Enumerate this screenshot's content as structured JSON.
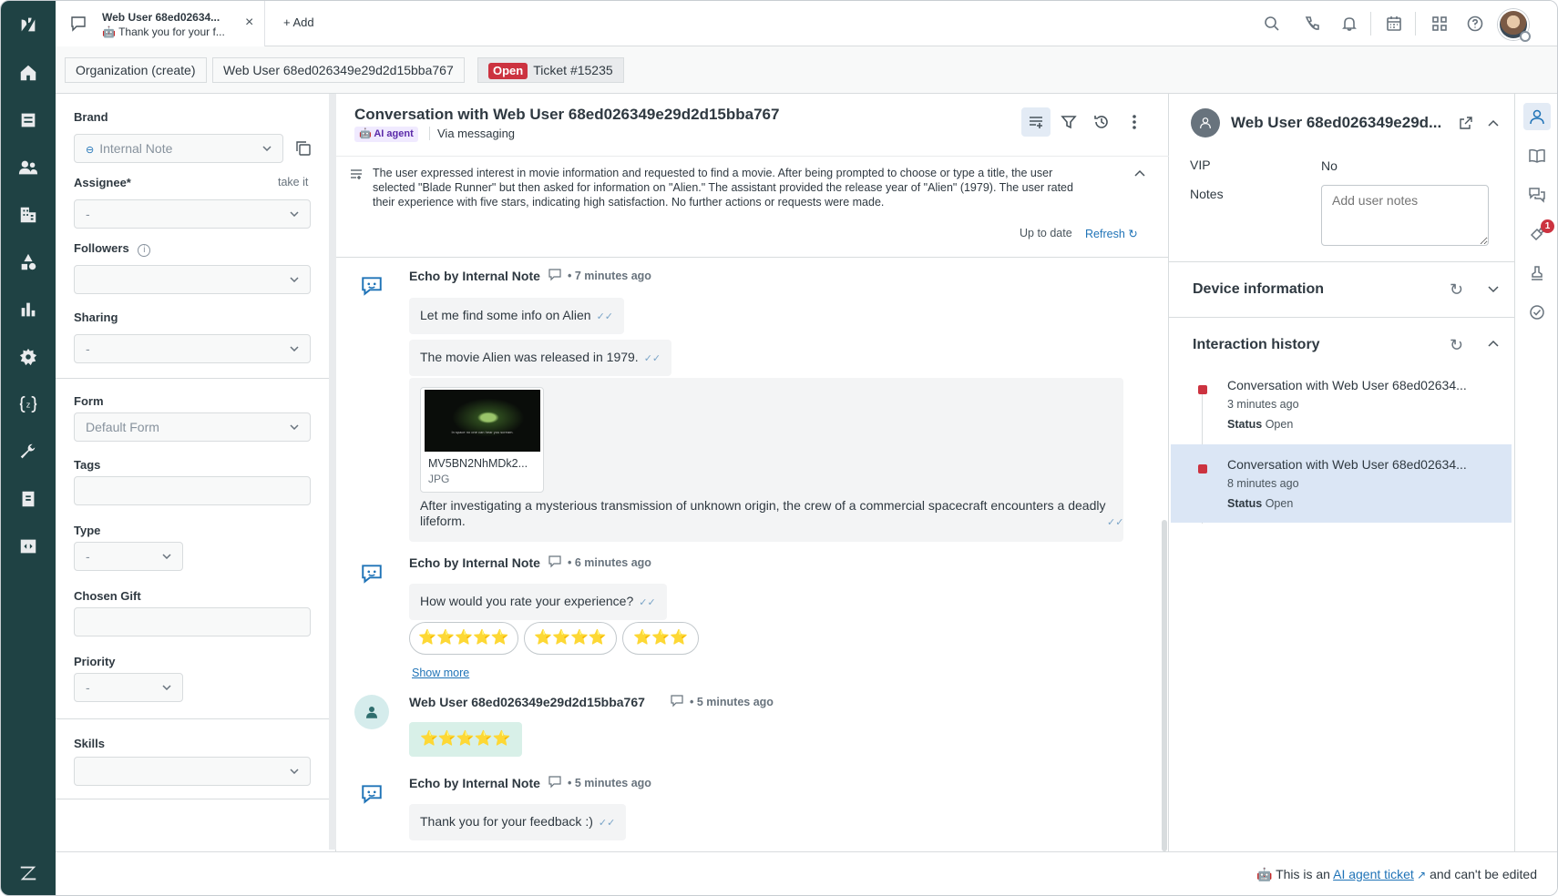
{
  "tab": {
    "title": "Web User 68ed02634...",
    "subtitle": "Thank you for your f...",
    "close": "×"
  },
  "topbar": {
    "add_label": "Add"
  },
  "breadcrumbs": {
    "org": "Organization (create)",
    "user": "Web User 68ed026349e29d2d15bba767",
    "status": "Open",
    "ticket": "Ticket #15235"
  },
  "left": {
    "brand_label": "Brand",
    "brand_value": "Internal Note",
    "assignee_label": "Assignee*",
    "take_it": "take it",
    "assignee_value": "-",
    "followers_label": "Followers",
    "sharing_label": "Sharing",
    "sharing_value": "-",
    "form_label": "Form",
    "form_value": "Default Form",
    "tags_label": "Tags",
    "type_label": "Type",
    "type_value": "-",
    "gift_label": "Chosen Gift",
    "priority_label": "Priority",
    "priority_value": "-",
    "skills_label": "Skills"
  },
  "conversation": {
    "title": "Conversation with Web User 68ed026349e29d2d15bba767",
    "ai_badge": "AI agent",
    "via": "Via messaging",
    "summary": "The user expressed interest in movie information and requested to find a movie. After being prompted to choose or type a title, the user selected \"Blade Runner\" but then asked for information on \"Alien.\" The assistant provided the release year of \"Alien\" (1979). The user rated their experience with five stars, indicating high satisfaction. No further actions or requests were made.",
    "up_to_date": "Up to date",
    "refresh": "Refresh",
    "messages": [
      {
        "author": "Echo by Internal Note",
        "time": "7 minutes ago",
        "bubbles": [
          "Let me find some info on Alien",
          "The movie Alien was released in 1979."
        ],
        "attachment": {
          "name": "MV5BN2NhMDk2...",
          "type": "JPG",
          "poster_text": "In space no one can hear you scream."
        },
        "description": "After investigating a mysterious transmission of unknown origin, the crew of a commercial spacecraft encounters a deadly lifeform."
      },
      {
        "author": "Echo by Internal Note",
        "time": "6 minutes ago",
        "bubbles": [
          "How would you rate your experience?"
        ],
        "ratings": [
          "⭐⭐⭐⭐⭐",
          "⭐⭐⭐⭐",
          "⭐⭐⭐"
        ],
        "show_more": "Show more"
      },
      {
        "author": "Web User 68ed026349e29d2d15bba767",
        "time": "5 minutes ago",
        "bubbles": [
          "⭐⭐⭐⭐⭐"
        ]
      },
      {
        "author": "Echo by Internal Note",
        "time": "5 minutes ago",
        "bubbles": [
          "Thank you for your feedback :)"
        ]
      }
    ],
    "dot": "•"
  },
  "right": {
    "user_name": "Web User 68ed026349e29d...",
    "vip_label": "VIP",
    "vip_value": "No",
    "notes_label": "Notes",
    "notes_placeholder": "Add user notes",
    "device_info": "Device information",
    "interaction_history": "Interaction history",
    "history": [
      {
        "title": "Conversation with Web User 68ed02634...",
        "time": "3 minutes ago",
        "status_label": "Status",
        "status": "Open"
      },
      {
        "title": "Conversation with Web User 68ed02634...",
        "time": "8 minutes ago",
        "status_label": "Status",
        "status": "Open"
      }
    ]
  },
  "sidebar_badge": "1",
  "footer": {
    "prefix": "This is an",
    "link": "AI agent ticket",
    "suffix": "and can't be edited"
  },
  "colors": {
    "nav": "#1f4244",
    "open_badge": "#cc3340",
    "link": "#1f73b7",
    "selected": "#dbe6f5"
  }
}
